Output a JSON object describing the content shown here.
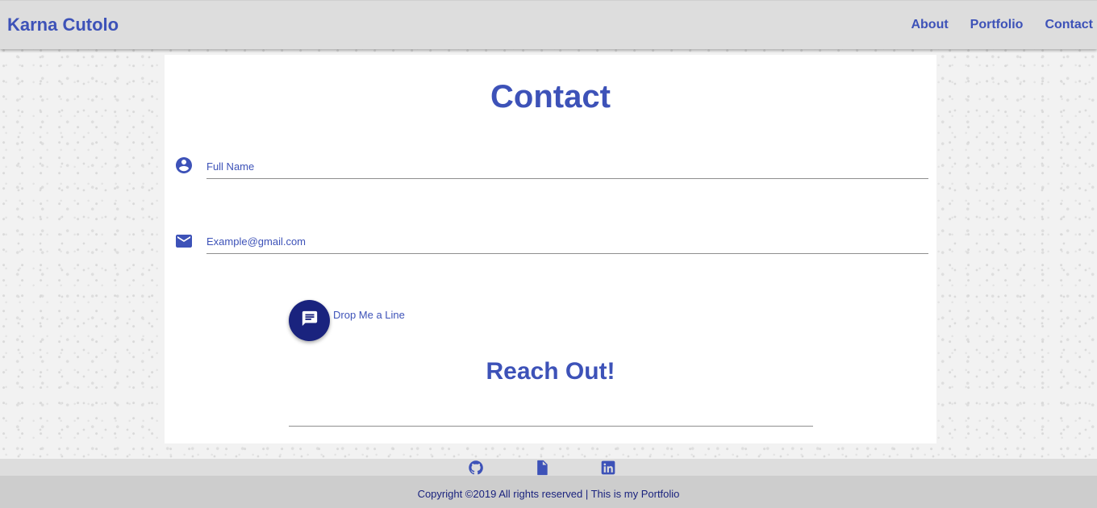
{
  "header": {
    "brand": "Karna Cutolo",
    "nav": [
      "About",
      "Portfolio",
      "Contact"
    ]
  },
  "contact": {
    "title": "Contact",
    "name_placeholder": "Full Name",
    "email_placeholder": "Example@gmail.com",
    "message_label": "Drop Me a Line",
    "reach_out": "Reach Out!"
  },
  "footer": {
    "icons": [
      "github-icon",
      "document-icon",
      "linkedin-icon"
    ],
    "copyright": "Copyright ©2019 All rights reserved | This is my Portfolio"
  },
  "colors": {
    "accent": "#3d52b8",
    "button": "#1a237e",
    "header_bg": "#dddddd",
    "footer_bg": "#cdcdcd"
  }
}
